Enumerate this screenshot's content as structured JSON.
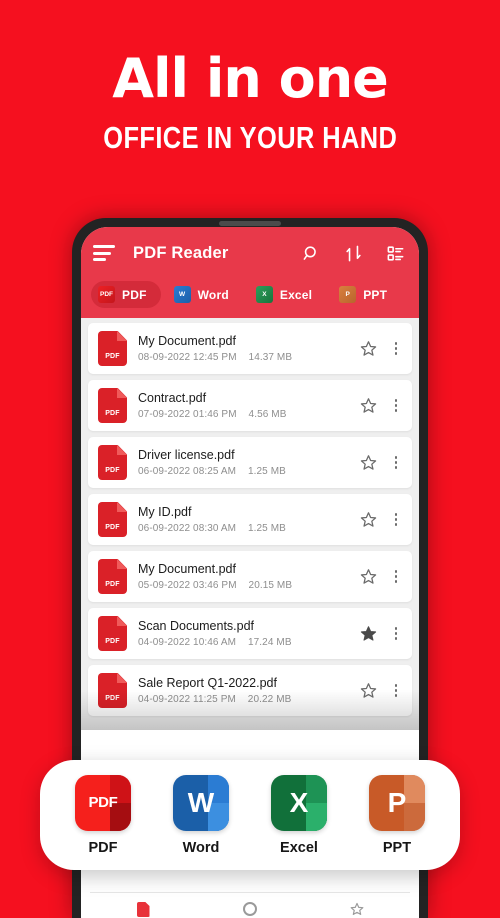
{
  "promo": {
    "title": "All in one",
    "subtitle": "OFFICE IN YOUR HAND"
  },
  "colors": {
    "background_red": "#F5101F",
    "appbar_red": "#E8394A",
    "pdf_red": "#DA2128",
    "word_blue": "#1B5FA8",
    "excel_green": "#11703A",
    "ppt_orange": "#C85A28"
  },
  "app": {
    "title": "PDF Reader",
    "menu_icon": "hamburger-menu-icon",
    "actions": [
      {
        "name": "search-icon",
        "label": "Search"
      },
      {
        "name": "sort-icon",
        "label": "Sort"
      },
      {
        "name": "view-list-icon",
        "label": "View"
      }
    ],
    "tabs": [
      {
        "label": "PDF",
        "icon": "pdf-icon",
        "active": true
      },
      {
        "label": "Word",
        "icon": "word-icon",
        "active": false
      },
      {
        "label": "Excel",
        "icon": "excel-icon",
        "active": false
      },
      {
        "label": "PPT",
        "icon": "powerpoint-icon",
        "active": false
      }
    ],
    "files": [
      {
        "name": "My Document.pdf",
        "date": "08-09-2022 12:45 PM",
        "size": "14.37 MB",
        "starred": false
      },
      {
        "name": "Contract.pdf",
        "date": "07-09-2022 01:46 PM",
        "size": "4.56 MB",
        "starred": false
      },
      {
        "name": "Driver license.pdf",
        "date": "06-09-2022 08:25 AM",
        "size": "1.25 MB",
        "starred": false
      },
      {
        "name": "My ID.pdf",
        "date": "06-09-2022 08:30 AM",
        "size": "1.25 MB",
        "starred": false
      },
      {
        "name": "My Document.pdf",
        "date": "05-09-2022 03:46 PM",
        "size": "20.15 MB",
        "starred": false
      },
      {
        "name": "Scan Documents.pdf",
        "date": "04-09-2022 10:46 AM",
        "size": "17.24 MB",
        "starred": true
      },
      {
        "name": "Sale Report Q1-2022.pdf",
        "date": "04-09-2022 11:25 PM",
        "size": "20.22 MB",
        "starred": false
      }
    ],
    "bottom_nav": [
      {
        "name": "nav-files-icon"
      },
      {
        "name": "nav-tools-icon"
      },
      {
        "name": "nav-favorites-icon"
      }
    ]
  },
  "format_card": {
    "items": [
      {
        "label": "PDF",
        "glyph": "PDF",
        "icon": "pdf-app-icon"
      },
      {
        "label": "Word",
        "glyph": "W",
        "icon": "word-app-icon"
      },
      {
        "label": "Excel",
        "glyph": "X",
        "icon": "excel-app-icon"
      },
      {
        "label": "PPT",
        "glyph": "P",
        "icon": "powerpoint-app-icon"
      }
    ]
  }
}
